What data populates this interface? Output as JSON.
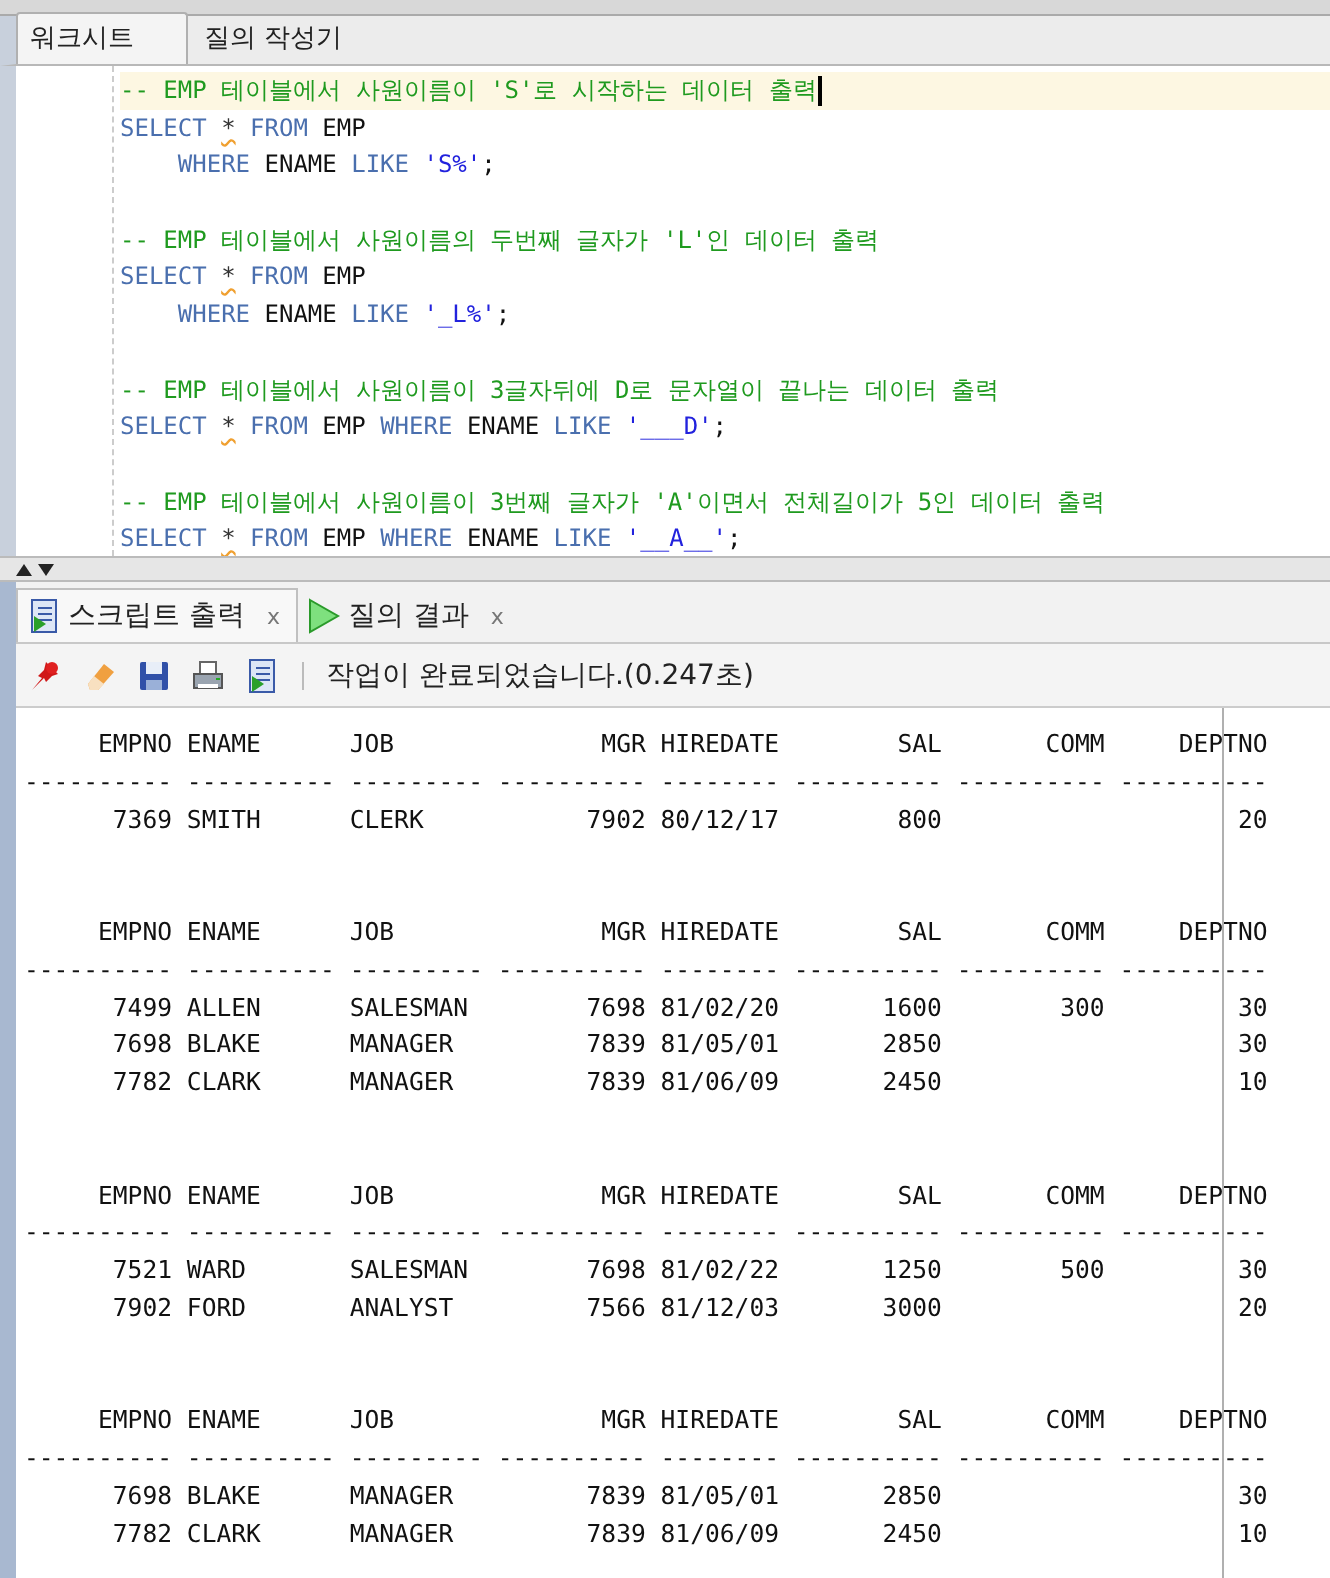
{
  "editor_tabs": [
    {
      "label": "워크시트",
      "selected": true
    },
    {
      "label": "질의 작성기",
      "selected": false
    }
  ],
  "editor": {
    "statements": [
      {
        "lines": [
          {
            "current": true,
            "tokens": [
              {
                "kind": "comment",
                "text": "-- EMP 테이블에서 사원이름이 'S'로 시작하는 데이터 출력"
              }
            ]
          },
          {
            "current": false,
            "tokens": [
              {
                "kind": "keyword",
                "text": "SELECT "
              },
              {
                "kind": "operator",
                "text": "*",
                "warning": true
              },
              {
                "kind": "keyword",
                "text": " FROM "
              },
              {
                "kind": "plain",
                "text": "EMP"
              }
            ]
          },
          {
            "current": false,
            "indent": true,
            "tokens": [
              {
                "kind": "keyword",
                "text": "WHERE "
              },
              {
                "kind": "plain",
                "text": "ENAME "
              },
              {
                "kind": "keyword",
                "text": "LIKE "
              },
              {
                "kind": "string",
                "text": "'S%'"
              },
              {
                "kind": "plain",
                "text": ";"
              }
            ]
          }
        ]
      },
      {
        "lines": [
          {
            "current": false,
            "tokens": [
              {
                "kind": "comment",
                "text": "-- EMP 테이블에서 사원이름의 두번째 글자가 'L'인 데이터 출력"
              }
            ]
          },
          {
            "current": false,
            "tokens": [
              {
                "kind": "keyword",
                "text": "SELECT "
              },
              {
                "kind": "operator",
                "text": "*",
                "warning": true
              },
              {
                "kind": "keyword",
                "text": " FROM "
              },
              {
                "kind": "plain",
                "text": "EMP"
              }
            ]
          },
          {
            "current": false,
            "indent": true,
            "tokens": [
              {
                "kind": "keyword",
                "text": "WHERE "
              },
              {
                "kind": "plain",
                "text": "ENAME "
              },
              {
                "kind": "keyword",
                "text": "LIKE "
              },
              {
                "kind": "string",
                "text": "'_L%'"
              },
              {
                "kind": "plain",
                "text": ";"
              }
            ]
          }
        ]
      },
      {
        "lines": [
          {
            "current": false,
            "tokens": [
              {
                "kind": "comment",
                "text": "-- EMP 테이블에서 사원이름이 3글자뒤에 D로 문자열이 끝나는 데이터 출력"
              }
            ]
          },
          {
            "current": false,
            "tokens": [
              {
                "kind": "keyword",
                "text": "SELECT "
              },
              {
                "kind": "operator",
                "text": "*",
                "warning": true
              },
              {
                "kind": "keyword",
                "text": " FROM "
              },
              {
                "kind": "plain",
                "text": "EMP "
              },
              {
                "kind": "keyword",
                "text": "WHERE "
              },
              {
                "kind": "plain",
                "text": "ENAME "
              },
              {
                "kind": "keyword",
                "text": "LIKE "
              },
              {
                "kind": "string",
                "text": "'___D'"
              },
              {
                "kind": "plain",
                "text": ";"
              }
            ]
          }
        ]
      },
      {
        "lines": [
          {
            "current": false,
            "tokens": [
              {
                "kind": "comment",
                "text": "-- EMP 테이블에서 사원이름이 3번째 글자가 'A'이면서 전체길이가 5인 데이터 출력"
              }
            ]
          },
          {
            "current": false,
            "tokens": [
              {
                "kind": "keyword",
                "text": "SELECT "
              },
              {
                "kind": "operator",
                "text": "*",
                "warning": true
              },
              {
                "kind": "keyword",
                "text": " FROM "
              },
              {
                "kind": "plain",
                "text": "EMP "
              },
              {
                "kind": "keyword",
                "text": "WHERE "
              },
              {
                "kind": "plain",
                "text": "ENAME "
              },
              {
                "kind": "keyword",
                "text": "LIKE "
              },
              {
                "kind": "string",
                "text": "'__A__'"
              },
              {
                "kind": "plain",
                "text": ";"
              }
            ]
          }
        ]
      }
    ]
  },
  "output_tabs": [
    {
      "label": "스크립트 출력",
      "kind": "script",
      "selected": true,
      "close": "x"
    },
    {
      "label": "질의 결과",
      "kind": "query",
      "selected": false,
      "close": "x"
    }
  ],
  "toolbar": {
    "status": "작업이 완료되었습니다.(0.247초)"
  },
  "results": [
    {
      "columns": [
        {
          "label": "EMPNO",
          "rule": "----------"
        },
        {
          "label": "ENAME",
          "rule": "----------"
        },
        {
          "label": "JOB",
          "rule": "---------"
        },
        {
          "label": "MGR",
          "rule": "----------"
        },
        {
          "label": "HIREDATE",
          "rule": "--------"
        },
        {
          "label": "SAL",
          "rule": "----------"
        },
        {
          "label": "COMM",
          "rule": "----------"
        },
        {
          "label": "DEPTNO",
          "rule": "----------"
        }
      ],
      "rows": [
        [
          "7369",
          "SMITH",
          "CLERK",
          "7902",
          "80/12/17",
          "800",
          null,
          "20"
        ]
      ]
    },
    {
      "columns": [
        {
          "label": "EMPNO",
          "rule": "----------"
        },
        {
          "label": "ENAME",
          "rule": "----------"
        },
        {
          "label": "JOB",
          "rule": "---------"
        },
        {
          "label": "MGR",
          "rule": "----------"
        },
        {
          "label": "HIREDATE",
          "rule": "--------"
        },
        {
          "label": "SAL",
          "rule": "----------"
        },
        {
          "label": "COMM",
          "rule": "----------"
        },
        {
          "label": "DEPTNO",
          "rule": "----------"
        }
      ],
      "rows": [
        [
          "7499",
          "ALLEN",
          "SALESMAN",
          "7698",
          "81/02/20",
          "1600",
          "300",
          "30"
        ],
        [
          "7698",
          "BLAKE",
          "MANAGER",
          "7839",
          "81/05/01",
          "2850",
          null,
          "30"
        ],
        [
          "7782",
          "CLARK",
          "MANAGER",
          "7839",
          "81/06/09",
          "2450",
          null,
          "10"
        ]
      ]
    },
    {
      "columns": [
        {
          "label": "EMPNO",
          "rule": "----------"
        },
        {
          "label": "ENAME",
          "rule": "----------"
        },
        {
          "label": "JOB",
          "rule": "---------"
        },
        {
          "label": "MGR",
          "rule": "----------"
        },
        {
          "label": "HIREDATE",
          "rule": "--------"
        },
        {
          "label": "SAL",
          "rule": "----------"
        },
        {
          "label": "COMM",
          "rule": "----------"
        },
        {
          "label": "DEPTNO",
          "rule": "----------"
        }
      ],
      "rows": [
        [
          "7521",
          "WARD",
          "SALESMAN",
          "7698",
          "81/02/22",
          "1250",
          "500",
          "30"
        ],
        [
          "7902",
          "FORD",
          "ANALYST",
          "7566",
          "81/12/03",
          "3000",
          null,
          "20"
        ]
      ]
    },
    {
      "columns": [
        {
          "label": "EMPNO",
          "rule": "----------"
        },
        {
          "label": "ENAME",
          "rule": "----------"
        },
        {
          "label": "JOB",
          "rule": "---------"
        },
        {
          "label": "MGR",
          "rule": "----------"
        },
        {
          "label": "HIREDATE",
          "rule": "--------"
        },
        {
          "label": "SAL",
          "rule": "----------"
        },
        {
          "label": "COMM",
          "rule": "----------"
        },
        {
          "label": "DEPTNO",
          "rule": "----------"
        }
      ],
      "rows": [
        [
          "7698",
          "BLAKE",
          "MANAGER",
          "7839",
          "81/05/01",
          "2850",
          null,
          "30"
        ],
        [
          "7782",
          "CLARK",
          "MANAGER",
          "7839",
          "81/06/09",
          "2450",
          null,
          "10"
        ]
      ]
    }
  ]
}
